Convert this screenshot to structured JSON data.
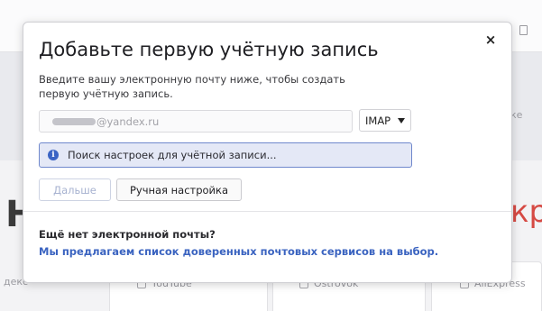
{
  "background": {
    "big_left_text": "Н",
    "big_right_text": "кр",
    "search_fragment": "ке",
    "bottom_left_fragment": "декс",
    "tiles": [
      {
        "label": "YouTube"
      },
      {
        "label": "Ostrovok"
      },
      {
        "label": "AliExpress"
      }
    ]
  },
  "dialog": {
    "title": "Добавьте первую учётную запись",
    "close_glyph": "×",
    "description": "Введите вашу электронную почту ниже, чтобы создать первую учётную запись.",
    "email_value": "@yandex.ru",
    "protocol": {
      "selected": "IMAP"
    },
    "info_banner": {
      "icon": "info-icon",
      "text": "Поиск настроек для учётной записи..."
    },
    "buttons": {
      "next_label": "Дальше",
      "manual_label": "Ручная настройка"
    },
    "footer": {
      "question": "Ещё нет электронной почты?",
      "link": "Мы предлагаем список доверенных почтовых сервисов на выбор."
    }
  },
  "colors": {
    "accent": "#3a63c0",
    "banner_bg": "#e4e8f6",
    "banner_border": "#6f88cc"
  }
}
